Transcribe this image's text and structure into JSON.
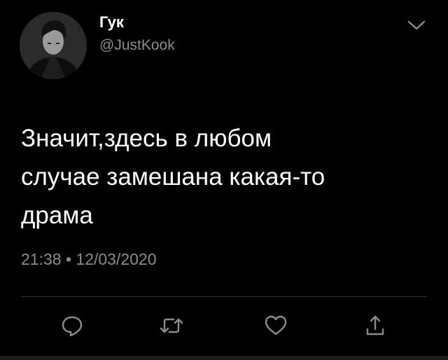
{
  "tweet": {
    "author_name": "Гук",
    "author_handle": "@JustKook",
    "text_lines": [
      "Значит,здесь в любом",
      "случае замешана какая-то",
      "драма"
    ],
    "time": "21:38",
    "separator": "•",
    "date": "12/03/2020"
  },
  "icons": {
    "more": "chevron-down-icon",
    "reply": "reply-icon",
    "retweet": "retweet-icon",
    "like": "heart-icon",
    "share": "share-icon"
  },
  "colors": {
    "background": "#000000",
    "text": "#ffffff",
    "muted": "#8b8b8b"
  }
}
